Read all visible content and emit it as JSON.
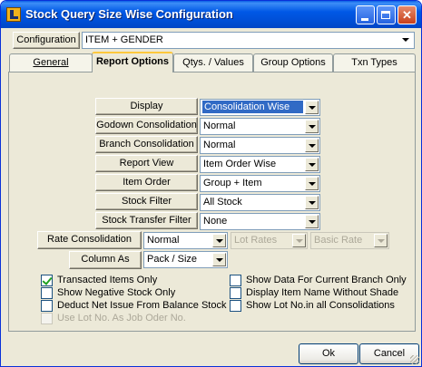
{
  "window": {
    "title": "Stock Query Size Wise Configuration"
  },
  "configuration": {
    "label": "Configuration",
    "value": "ITEM + GENDER"
  },
  "tabs": [
    {
      "label": "General"
    },
    {
      "label": "Report Options"
    },
    {
      "label": "Qtys. / Values"
    },
    {
      "label": "Group Options"
    },
    {
      "label": "Txn Types"
    }
  ],
  "fields": {
    "display": {
      "label": "Display",
      "value": "Consolidation Wise"
    },
    "godown_consolidation": {
      "label": "Godown Consolidation",
      "value": "Normal"
    },
    "branch_consolidation": {
      "label": "Branch Consolidation",
      "value": "Normal"
    },
    "report_view": {
      "label": "Report View",
      "value": "Item Order Wise"
    },
    "item_order": {
      "label": "Item Order",
      "value": "Group + Item"
    },
    "stock_filter": {
      "label": "Stock Filter",
      "value": "All Stock"
    },
    "stock_transfer_filter": {
      "label": "Stock Transfer Filter",
      "value": "None"
    },
    "rate_consolidation": {
      "label": "Rate Consolidation",
      "value": "Normal",
      "lot_rates": "Lot Rates",
      "basic_rate": "Basic Rate"
    },
    "column_as": {
      "label": "Column As",
      "value": "Pack / Size"
    }
  },
  "checkboxes": {
    "transacted_items_only": {
      "label": "Transacted Items Only",
      "checked": true
    },
    "show_negative_stock_only": {
      "label": "Show Negative Stock Only",
      "checked": false
    },
    "deduct_net_issue": {
      "label": "Deduct Net Issue From Balance Stock",
      "checked": false
    },
    "use_lot_no": {
      "label": "Use Lot No. As Job Oder No.",
      "checked": false
    },
    "show_data_current_branch": {
      "label": "Show Data For Current Branch Only",
      "checked": false
    },
    "display_item_name_without_shade": {
      "label": "Display Item Name Without Shade",
      "checked": false
    },
    "show_lot_no_all_consolidations": {
      "label": "Show Lot No.in all Consolidations",
      "checked": false
    }
  },
  "buttons": {
    "ok": "Ok",
    "cancel": "Cancel"
  }
}
